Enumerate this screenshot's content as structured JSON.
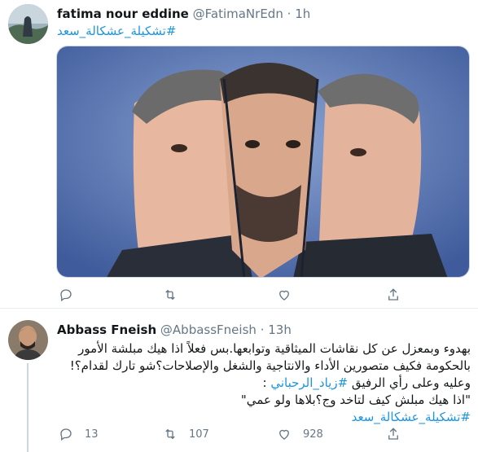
{
  "tweet1": {
    "author_name": "fatima nour eddine",
    "handle": "@FatimaNrEdn",
    "separator": "·",
    "time": "1h",
    "hashtag": "#تشكيلة_عشكالة_سعد",
    "icons": [
      "reply-icon",
      "retweet-icon",
      "like-icon",
      "share-icon"
    ]
  },
  "tweet2": {
    "author_name": "Abbass Fneish",
    "handle": "@AbbassFneish",
    "separator": "·",
    "time": "13h",
    "line1": "بهدوء وبمعزل عن كل نقاشات الميثاقية وتوابعها.بس فعلاً اذا هيك مبلشة الأمور",
    "line2": "بالحكومة فكيف متصورين الأداء والانتاجية والشغل والإصلاحات؟شو تارك لقدام؟!",
    "line3_text": "وعليه وعلى رأي الرفيق ",
    "line3_hashtag": "#زياد_الرحباني",
    "line3_end": " :",
    "line4": "\"اذا هيك مبلش كيف لتاخد وج؟بلاها ولو عمي\"",
    "line5_hashtag": "#تشكيلة_عشكالة_سعد",
    "reply_count": "13",
    "retweet_count": "107",
    "like_count": "928",
    "icons": [
      "reply-icon",
      "retweet-icon",
      "like-icon",
      "share-icon"
    ]
  },
  "colors": {
    "link": "#1b95e0",
    "muted": "#657786",
    "divider": "#e6ecf0",
    "media_bg": "#5b76b5"
  }
}
